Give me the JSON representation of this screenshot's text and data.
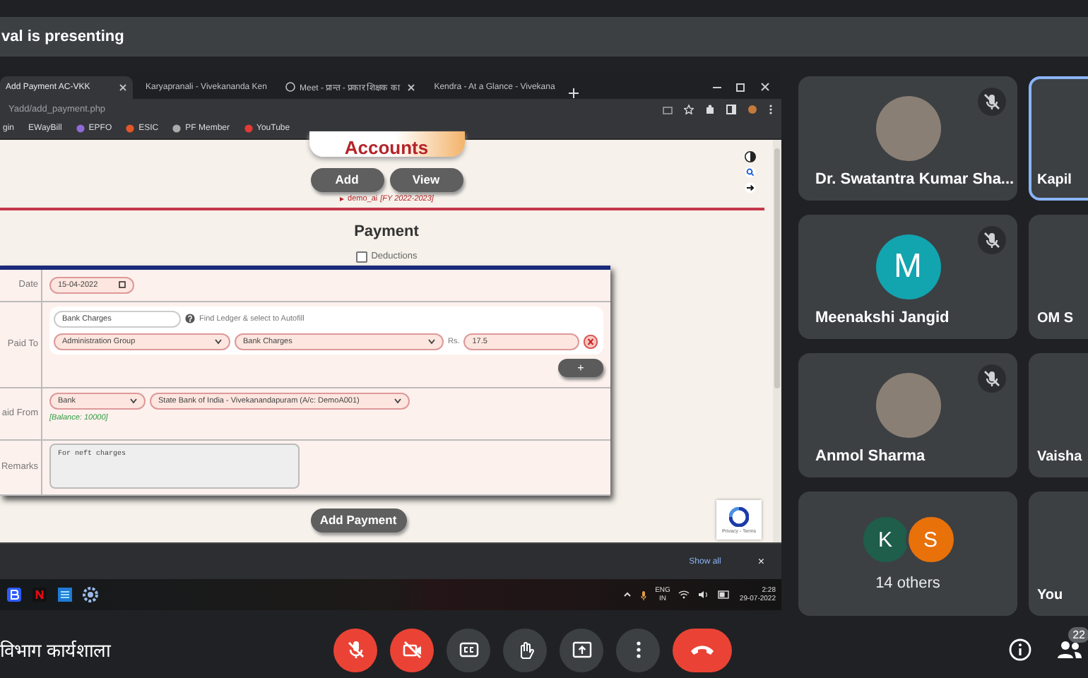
{
  "presenter_banner": {
    "text": "val is presenting"
  },
  "shared_screen": {
    "browser": {
      "tabs": [
        {
          "label": "Add Payment AC-VKK",
          "selected": true
        },
        {
          "label": "Karyapranali - Vivekananda Ken",
          "selected": false
        },
        {
          "label": "Meet - प्रान्त - प्रकार शिक्षक का",
          "selected": false
        },
        {
          "label": "Kendra - At a Glance - Vivekana",
          "selected": false
        }
      ],
      "address": "Yadd/add_payment.php",
      "bookmarks": [
        "gin",
        "EWayBill",
        "EPFO",
        "ESIC",
        "PF Member",
        "YouTube"
      ]
    },
    "page": {
      "logo": "Accounts",
      "buttons": [
        "Add",
        "View"
      ],
      "account": "demo_ai",
      "fy": "[FY 2022-2023]",
      "heading": "Payment",
      "deductions": {
        "label": "Deductions",
        "checked": false
      },
      "form": {
        "date": {
          "label": "Date",
          "value": "15-04-2022"
        },
        "paid_to": {
          "label": "Paid To",
          "search": "Bank Charges",
          "hint": "Find Ledger & select to Autofill",
          "group": "Administration Group",
          "ledger": "Bank Charges",
          "currency": "Rs.",
          "amount": "17.5",
          "add": "+"
        },
        "paid_from": {
          "label": "aid From",
          "type": "Bank",
          "account": "State Bank of India - Vivekanandapuram (A/c: DemoA001)",
          "balance": "[Balance: 10000]"
        },
        "remarks": {
          "label": "Remarks",
          "value": "For neft charges"
        }
      },
      "submit": "Add Payment",
      "recaptcha": "Privacy - Terms"
    },
    "download_bar": {
      "show_all": "Show all",
      "close": "×"
    },
    "taskbar": {
      "language": "ENG",
      "region": "IN",
      "time": "2:28",
      "date": "29-07-2022"
    }
  },
  "tiles": [
    {
      "kind": "person",
      "name": "Dr. Swatantra Kumar Sha...",
      "muted": true,
      "highlighted": false,
      "photo": true
    },
    {
      "kind": "person",
      "name": "Kapil",
      "muted": false,
      "highlighted": true,
      "photo": false
    },
    {
      "kind": "person",
      "name": "Meenakshi Jangid",
      "muted": true,
      "highlighted": false,
      "photo": false,
      "letter": "M",
      "color": "#12a4af"
    },
    {
      "kind": "person",
      "name": "OM S",
      "muted": false,
      "highlighted": false,
      "photo": false
    },
    {
      "kind": "person",
      "name": "Anmol Sharma",
      "muted": true,
      "highlighted": false,
      "photo": true
    },
    {
      "kind": "person",
      "name": "Vaisha",
      "muted": false,
      "highlighted": false,
      "photo": false
    },
    {
      "kind": "others",
      "label": "14 others",
      "avatars": [
        {
          "letter": "K",
          "color": "#1e5e4a"
        },
        {
          "letter": "S",
          "color": "#e8710a"
        }
      ]
    },
    {
      "kind": "person",
      "name": "You",
      "muted": false,
      "highlighted": false,
      "photo": false
    }
  ],
  "bottom_bar": {
    "meeting_title": "विभाग कार्यशाला",
    "mic_on": false,
    "camera_on": false,
    "people_count": "22"
  }
}
